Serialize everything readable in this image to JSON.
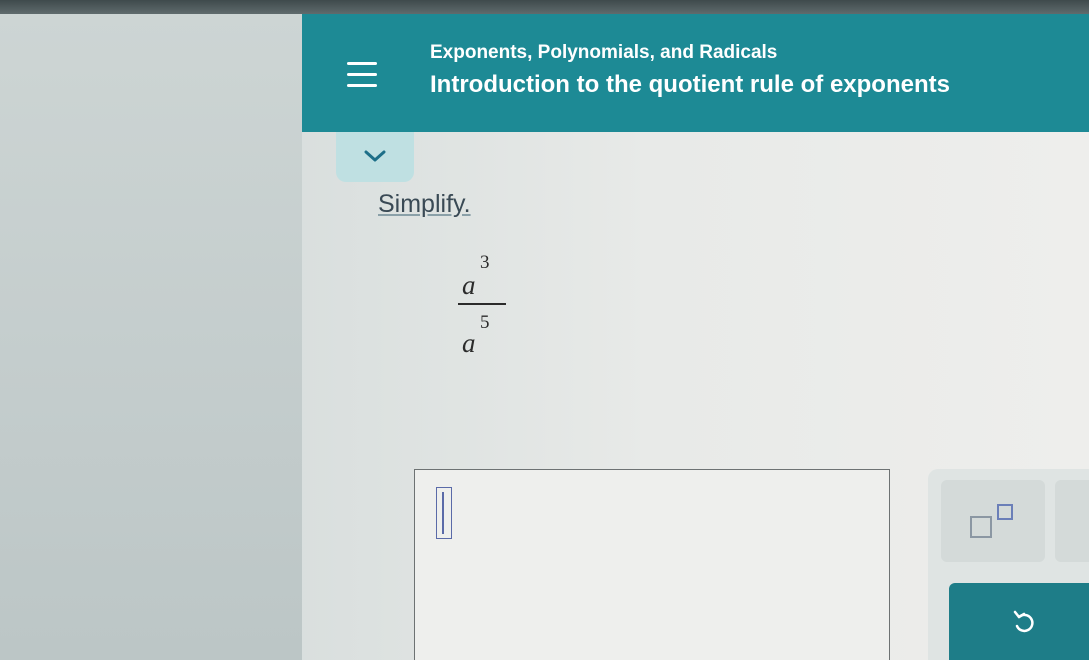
{
  "header": {
    "subtitle": "Exponents, Polynomials, and Radicals",
    "title": "Introduction to the quotient rule of exponents",
    "background_color": "#1d8a95"
  },
  "menu_button": {
    "icon": "hamburger-menu-icon"
  },
  "collapse_button": {
    "icon": "chevron-down-icon"
  },
  "question": {
    "prompt": "Simplify.",
    "expression": {
      "numerator": {
        "base": "a",
        "exponent": "3"
      },
      "denominator": {
        "base": "a",
        "exponent": "5"
      }
    }
  },
  "answer": {
    "value": ""
  },
  "toolbar": {
    "superscript_button": {
      "icon": "superscript-template-icon"
    },
    "undo_button": {
      "icon": "undo-icon",
      "color": "#1e7d88"
    }
  }
}
